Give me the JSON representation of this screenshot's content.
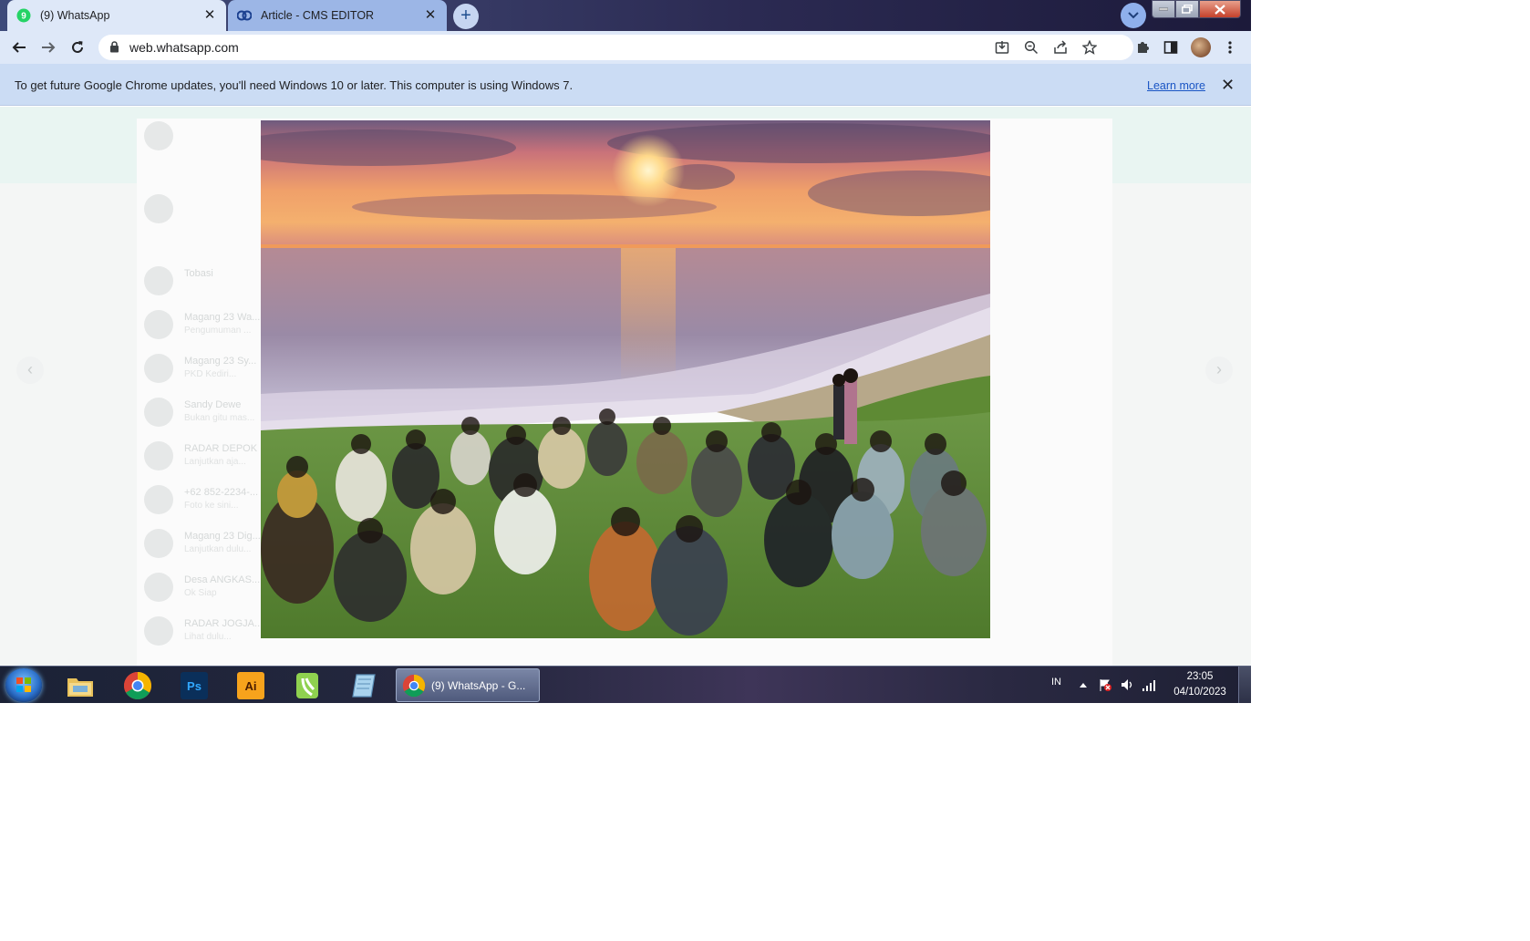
{
  "tabs": [
    {
      "label": "(9) WhatsApp",
      "active": true
    },
    {
      "label": "Article - CMS EDITOR",
      "active": false
    }
  ],
  "toolbar": {
    "url": "web.whatsapp.com"
  },
  "infobar": {
    "message": "To get future Google Chrome updates, you'll need Windows 10 or later. This computer is using Windows 7.",
    "link": "Learn more"
  },
  "chat_list": [
    {
      "name": "",
      "preview": ""
    },
    {
      "name": "Tobasi",
      "preview": ""
    },
    {
      "name": "Magang 23 Wa...",
      "preview": "Pengumuman ..."
    },
    {
      "name": "Magang 23 Sy...",
      "preview": "PKD Kediri..."
    },
    {
      "name": "Sandy Dewe",
      "preview": "Bukan gitu mas..."
    },
    {
      "name": "RADAR DEPOK",
      "preview": "Lanjutkan aja..."
    },
    {
      "name": "+62 852-2234-...",
      "preview": "Foto ke sini..."
    },
    {
      "name": "Magang 23 Dig...",
      "preview": "Lanjutkan dulu..."
    },
    {
      "name": "Desa ANGKAS...",
      "preview": "Ok Siap"
    },
    {
      "name": "RADAR JOGJA...",
      "preview": "Lihat dulu..."
    }
  ],
  "taskbar": {
    "active_window_label": "(9) WhatsApp - G...",
    "language": "IN",
    "time": "23:05",
    "date": "04/10/2023"
  },
  "colors": {
    "tab_active_bg": "#dee8f8",
    "infobar_bg": "#cbdcf4",
    "link": "#1a55c4",
    "whatsapp_green": "#25d366"
  },
  "icons": {
    "toolbar": [
      "back-icon",
      "forward-icon",
      "reload-icon",
      "lock-icon",
      "install-icon",
      "zoom-icon",
      "share-icon",
      "bookmark-star-icon",
      "extensions-icon",
      "side-panel-icon",
      "profile-avatar",
      "menu-icon"
    ],
    "taskbar": [
      "windows-start-icon",
      "file-explorer-icon",
      "chrome-icon",
      "photoshop-icon",
      "illustrator-icon",
      "app-icon",
      "notepad-icon"
    ]
  }
}
